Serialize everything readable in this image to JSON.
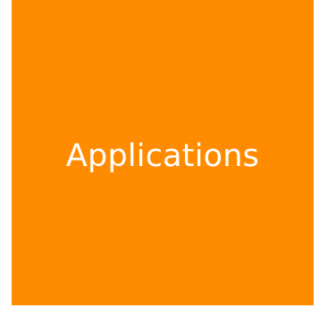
{
  "tile": {
    "label": "Applications",
    "background_color": "#FF8C00",
    "text_color": "#FFFFFF"
  }
}
